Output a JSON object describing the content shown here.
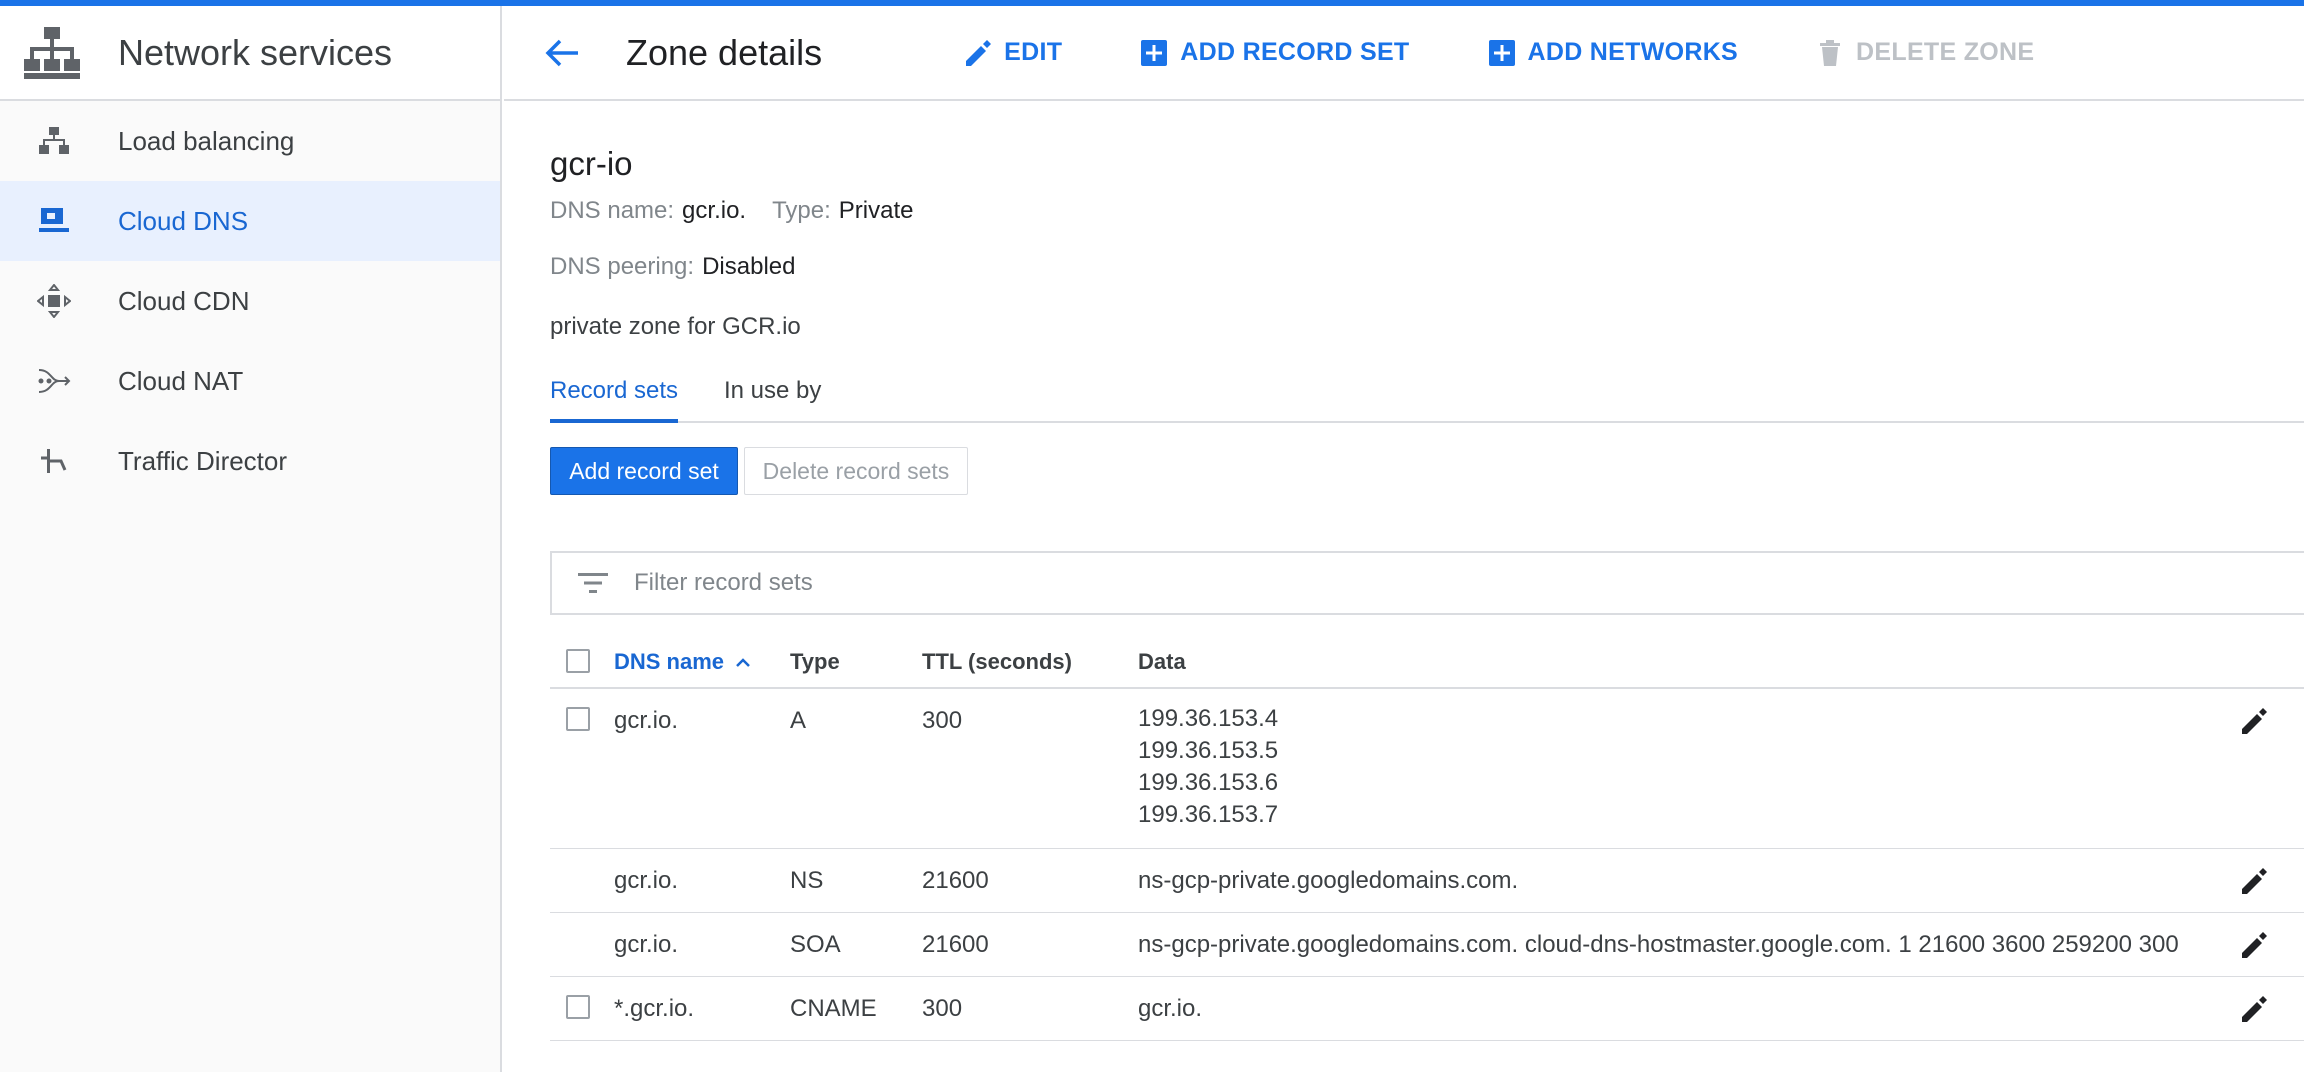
{
  "sidebar": {
    "title": "Network services",
    "items": [
      {
        "label": "Load balancing"
      },
      {
        "label": "Cloud DNS"
      },
      {
        "label": "Cloud CDN"
      },
      {
        "label": "Cloud NAT"
      },
      {
        "label": "Traffic Director"
      }
    ],
    "active_item": "Cloud DNS"
  },
  "header": {
    "title": "Zone details",
    "actions": {
      "edit": "EDIT",
      "add_record_set": "ADD RECORD SET",
      "add_networks": "ADD NETWORKS",
      "delete_zone": "DELETE ZONE"
    }
  },
  "zone": {
    "name": "gcr-io",
    "dns_name_label": "DNS name:",
    "dns_name_value": "gcr.io.",
    "type_label": "Type:",
    "type_value": "Private",
    "peering_label": "DNS peering:",
    "peering_value": "Disabled",
    "description": "private zone for GCR.io"
  },
  "tabs": [
    {
      "label": "Record sets",
      "active": true
    },
    {
      "label": "In use by",
      "active": false
    }
  ],
  "buttons": {
    "add_record_set": "Add record set",
    "delete_record_sets": "Delete record sets"
  },
  "filter": {
    "placeholder": "Filter record sets"
  },
  "table": {
    "headers": {
      "dns_name": "DNS name",
      "type": "Type",
      "ttl": "TTL (seconds)",
      "data": "Data"
    },
    "rows": [
      {
        "dns_name": "gcr.io.",
        "type": "A",
        "ttl": "300",
        "data": [
          "199.36.153.4",
          "199.36.153.5",
          "199.36.153.6",
          "199.36.153.7"
        ],
        "selectable": true
      },
      {
        "dns_name": "gcr.io.",
        "type": "NS",
        "ttl": "21600",
        "data": [
          "ns-gcp-private.googledomains.com."
        ],
        "selectable": false
      },
      {
        "dns_name": "gcr.io.",
        "type": "SOA",
        "ttl": "21600",
        "data": [
          "ns-gcp-private.googledomains.com. cloud-dns-hostmaster.google.com. 1 21600 3600 259200 300"
        ],
        "selectable": false
      },
      {
        "dns_name": "*.gcr.io.",
        "type": "CNAME",
        "ttl": "300",
        "data": [
          "gcr.io."
        ],
        "selectable": true
      }
    ]
  },
  "colors": {
    "accent": "#1a73e8",
    "active_bg": "#e8f0fe",
    "disabled": "#bdc1c6",
    "divider": "#dadce0"
  }
}
